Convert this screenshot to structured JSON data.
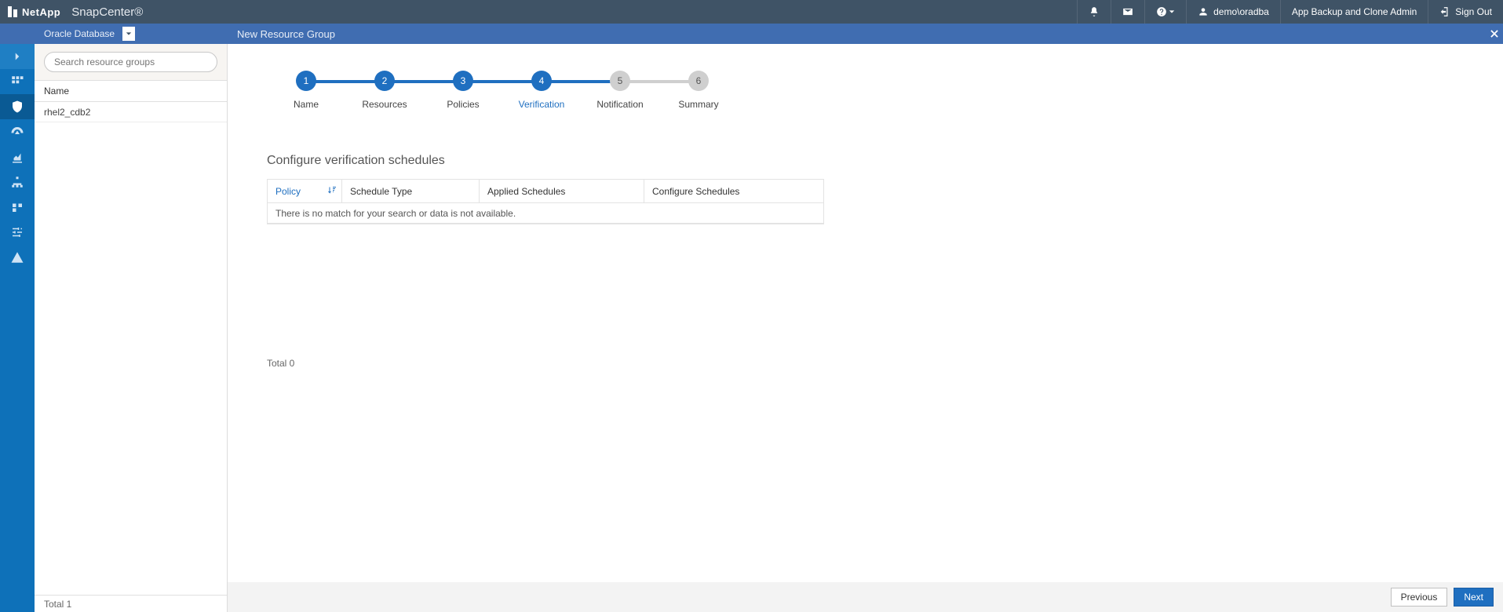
{
  "brand": {
    "company": "NetApp",
    "product": "SnapCenter®"
  },
  "topbar": {
    "user": "demo\\oradba",
    "role": "App Backup and Clone Admin",
    "signout": "Sign Out"
  },
  "subheader": {
    "db": "Oracle Database",
    "title": "New Resource Group"
  },
  "sidebar": {
    "search_placeholder": "Search resource groups",
    "name_header": "Name",
    "items": [
      "rhel2_cdb2"
    ],
    "total_label": "Total 1"
  },
  "wizard": {
    "steps": [
      {
        "num": "1",
        "label": "Name",
        "state": "done"
      },
      {
        "num": "2",
        "label": "Resources",
        "state": "done"
      },
      {
        "num": "3",
        "label": "Policies",
        "state": "done"
      },
      {
        "num": "4",
        "label": "Verification",
        "state": "active"
      },
      {
        "num": "5",
        "label": "Notification",
        "state": "pending"
      },
      {
        "num": "6",
        "label": "Summary",
        "state": "pending"
      }
    ],
    "section_title": "Configure verification schedules",
    "columns": {
      "policy": "Policy",
      "schedule": "Schedule Type",
      "applied": "Applied Schedules",
      "configure": "Configure Schedules"
    },
    "empty": "There is no match for your search or data is not available.",
    "total": "Total 0",
    "prev": "Previous",
    "next": "Next"
  }
}
